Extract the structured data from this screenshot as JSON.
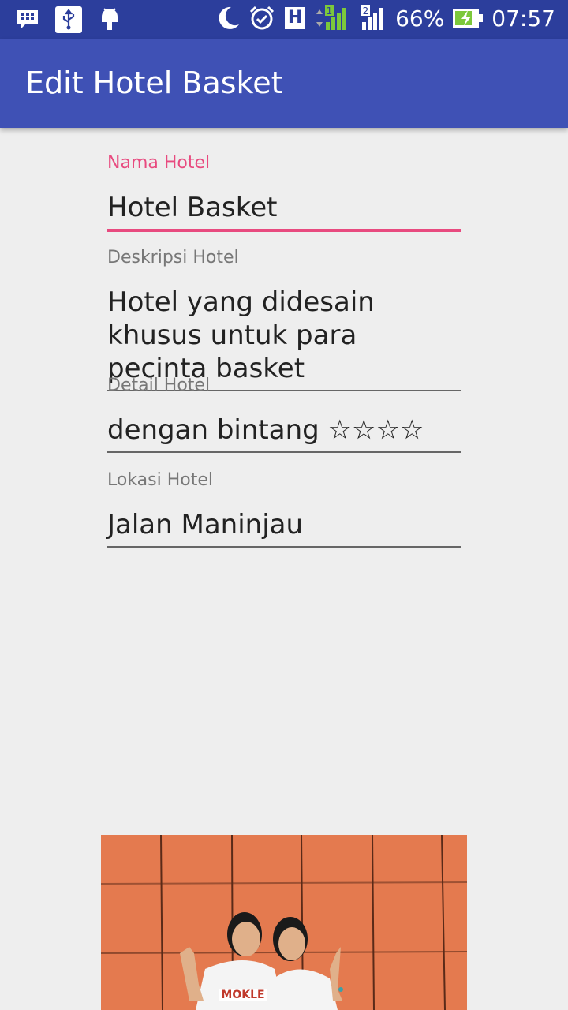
{
  "status_bar": {
    "battery": "66%",
    "time": "07:57",
    "network": "H",
    "sim1": "1",
    "sim2": "2"
  },
  "app_bar": {
    "title": "Edit Hotel Basket"
  },
  "form": {
    "nama_hotel": {
      "label": "Nama Hotel",
      "value": "Hotel Basket"
    },
    "deskripsi_hotel": {
      "label": "Deskripsi Hotel",
      "value": "Hotel yang didesain khusus untuk para pecinta basket"
    },
    "detail_hotel": {
      "label": "Detail Hotel",
      "value": "dengan bintang ☆☆☆☆"
    },
    "lokasi_hotel": {
      "label": "Lokasi Hotel",
      "value": "Jalan Maninjau"
    }
  },
  "photo": {
    "jersey_text": "MOKLE"
  },
  "colors": {
    "status_bar": "#2c3e9c",
    "app_bar": "#3f51b5",
    "accent": "#e84a7f",
    "background": "#eeeeee",
    "photo_wall": "#e47a4f"
  }
}
